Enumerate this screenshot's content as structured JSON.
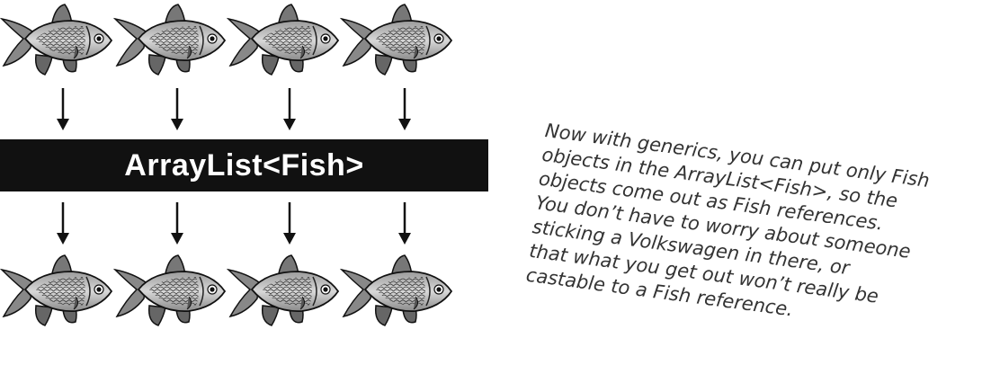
{
  "diagram": {
    "top_fish_count": 4,
    "bottom_fish_count": 4,
    "container_label": "ArrayList<Fish>",
    "fish_icon": "fish-icon",
    "arrow_icon": "arrow-down-icon",
    "note_lines": [
      "Now with generics, you can put only Fish",
      "objects in the ArrayList<Fish>, so the",
      "objects come out as Fish references.",
      "You don’t have to worry about someone",
      "sticking a Volkswagen in there, or",
      "that what you get out won’t really be",
      "castable to a Fish reference."
    ]
  }
}
